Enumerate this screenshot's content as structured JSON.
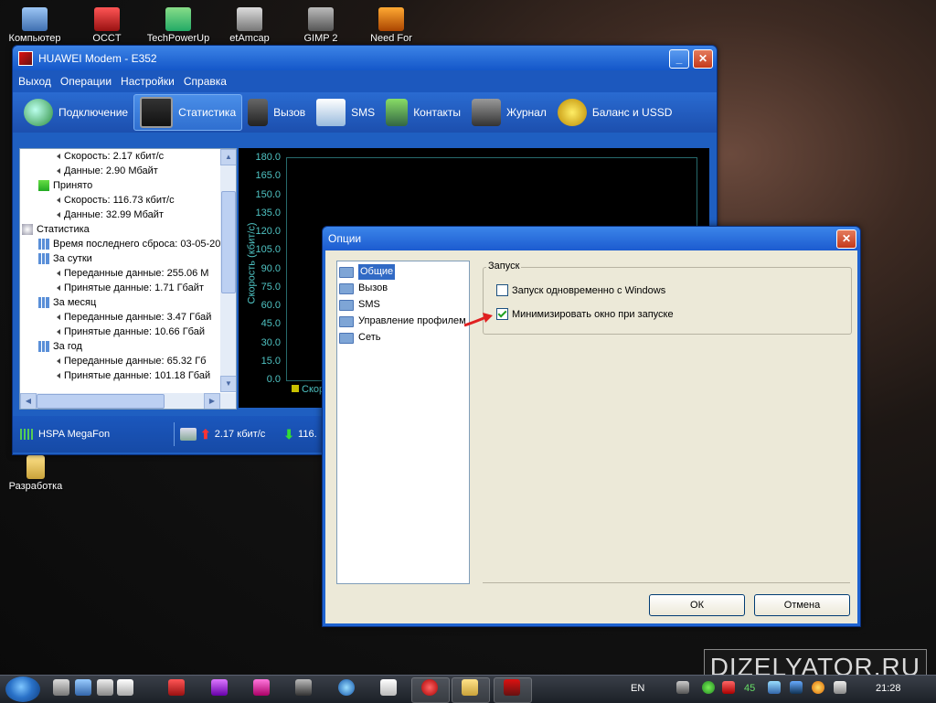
{
  "desktop": {
    "icons": [
      {
        "label": "Компьютер"
      },
      {
        "label": "OCCT"
      },
      {
        "label": "TechPowerUp"
      },
      {
        "label": "etAmcap"
      },
      {
        "label": "GIMP 2"
      },
      {
        "label": "Need For"
      },
      {
        "label": "Разработка"
      }
    ],
    "watermark": "DIZELYATOR.RU"
  },
  "main_window": {
    "title": "HUAWEI Modem - E352",
    "menu": [
      "Выход",
      "Операции",
      "Настройки",
      "Справка"
    ],
    "toolbar": [
      "Подключение",
      "Статистика",
      "Вызов",
      "SMS",
      "Контакты",
      "Журнал",
      "Баланс и USSD"
    ],
    "tree": [
      {
        "text": "Скорость: 2.17 кбит/с",
        "level": 2
      },
      {
        "text": "Данные: 2.90 Мбайт",
        "level": 2
      },
      {
        "text": "Принято",
        "level": 1
      },
      {
        "text": "Скорость: 116.73 кбит/с",
        "level": 2
      },
      {
        "text": "Данные: 32.99 Мбайт",
        "level": 2
      },
      {
        "text": "Статистика",
        "level": 0
      },
      {
        "text": "Время последнего сброса: 03-05-20",
        "level": 1
      },
      {
        "text": "За сутки",
        "level": 1
      },
      {
        "text": "Переданные данные: 255.06 М",
        "level": 2
      },
      {
        "text": "Принятые данные: 1.71 Гбайт",
        "level": 2
      },
      {
        "text": "За месяц",
        "level": 1
      },
      {
        "text": "Переданные данные: 3.47 Гбай",
        "level": 2
      },
      {
        "text": "Принятые данные: 10.66 Гбай",
        "level": 2
      },
      {
        "text": "За год",
        "level": 1
      },
      {
        "text": "Переданные данные: 65.32 Гб",
        "level": 2
      },
      {
        "text": "Принятые данные: 101.18 Гбай",
        "level": 2
      }
    ],
    "chart": {
      "ylabel": "Скорость (кбит/с)",
      "legend": "Скор",
      "ticks": [
        "180.0",
        "165.0",
        "150.0",
        "135.0",
        "120.0",
        "105.0",
        "90.0",
        "75.0",
        "60.0",
        "45.0",
        "30.0",
        "15.0",
        "0.0"
      ]
    },
    "status": {
      "network": "HSPA MegaFon",
      "upload": "2.17 кбит/с",
      "download": "116."
    }
  },
  "options_dialog": {
    "title": "Опции",
    "nav": [
      "Общие",
      "Вызов",
      "SMS",
      "Управление профилем",
      "Сеть"
    ],
    "selected_nav": "Общие",
    "group_title": "Запуск",
    "checkbox_1": {
      "label": "Запуск одновременно с Windows",
      "checked": false
    },
    "checkbox_2": {
      "label": "Минимизировать окно при запуске",
      "checked": true
    },
    "ok": "ОК",
    "cancel": "Отмена"
  },
  "taskbar": {
    "lang": "EN",
    "clock": "21:28",
    "tray_number": "45"
  }
}
